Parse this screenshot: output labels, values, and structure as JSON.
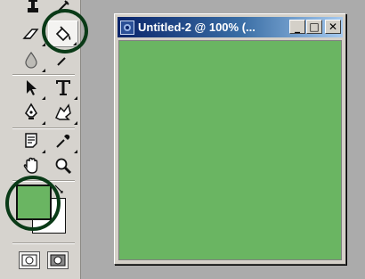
{
  "app": {
    "document_title": "Untitled-2 @ 100% (..."
  },
  "window_buttons": {
    "minimize": "_",
    "maximize": "□",
    "close": "✕"
  },
  "toolbox": {
    "tools": [
      {
        "name": "stamp-tool",
        "icon": "stamp-icon",
        "glyph": "⛀"
      },
      {
        "name": "history-brush-tool",
        "icon": "history-brush-icon",
        "glyph": "✎"
      },
      {
        "name": "eraser-tool",
        "icon": "eraser-icon",
        "glyph": "◿"
      },
      {
        "name": "paint-bucket-tool",
        "icon": "paint-bucket-icon",
        "glyph": "🪣",
        "active": true
      },
      {
        "name": "blur-tool",
        "icon": "water-drop-icon",
        "glyph": "💧"
      },
      {
        "name": "dodge-tool",
        "icon": "dodge-icon",
        "glyph": "◐"
      },
      {
        "name": "path-selection-tool",
        "icon": "arrow-pointer-icon",
        "glyph": "➤"
      },
      {
        "name": "type-tool",
        "icon": "type-icon",
        "glyph": "T"
      },
      {
        "name": "pen-tool",
        "icon": "pen-nib-icon",
        "glyph": "✒"
      },
      {
        "name": "custom-shape-tool",
        "icon": "shape-icon",
        "glyph": "✶"
      },
      {
        "name": "notes-tool",
        "icon": "note-icon",
        "glyph": "🗒"
      },
      {
        "name": "eyedropper-tool",
        "icon": "eyedropper-icon",
        "glyph": "⟋"
      },
      {
        "name": "hand-tool",
        "icon": "hand-icon",
        "glyph": "✋"
      },
      {
        "name": "zoom-tool",
        "icon": "magnifier-icon",
        "glyph": "⚲"
      }
    ],
    "foreground_color": "#6ab562",
    "background_color": "#ffffff",
    "highlight_ring_color": "#0a3a17"
  },
  "canvas": {
    "fill_color": "#6ab562"
  }
}
